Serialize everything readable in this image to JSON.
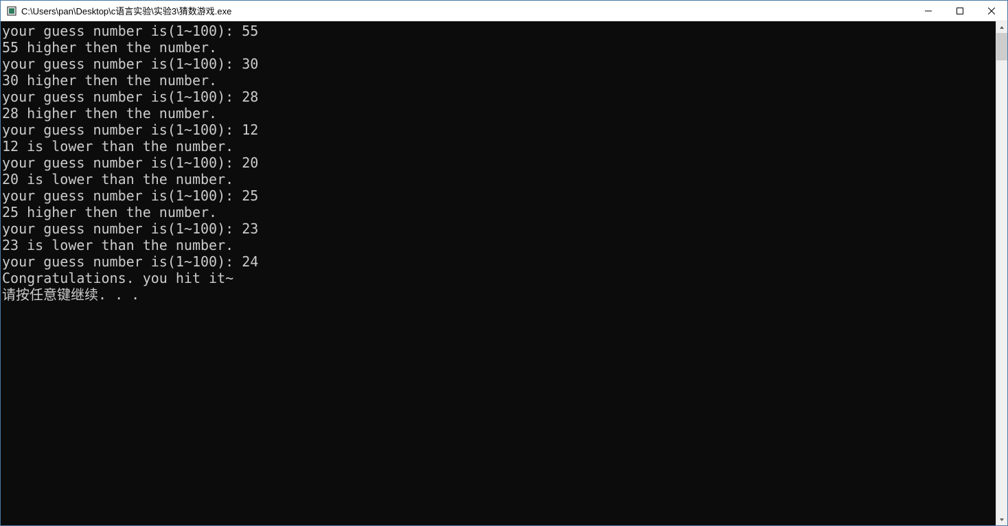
{
  "window": {
    "title": "C:\\Users\\pan\\Desktop\\c语言实验\\实验3\\猜数游戏.exe"
  },
  "console": {
    "lines": [
      "your guess number is(1~100): 55",
      "55 higher then the number.",
      "your guess number is(1~100): 30",
      "30 higher then the number.",
      "your guess number is(1~100): 28",
      "28 higher then the number.",
      "your guess number is(1~100): 12",
      "12 is lower than the number.",
      "your guess number is(1~100): 20",
      "20 is lower than the number.",
      "your guess number is(1~100): 25",
      "25 higher then the number.",
      "your guess number is(1~100): 23",
      "23 is lower than the number.",
      "your guess number is(1~100): 24",
      "Congratulations. you hit it~",
      "请按任意键继续. . ."
    ]
  }
}
